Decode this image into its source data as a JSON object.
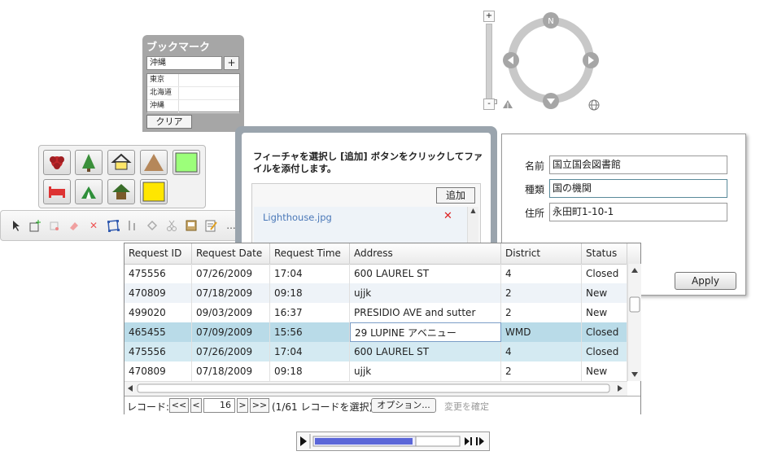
{
  "bookmark": {
    "title": "ブックマーク",
    "input_value": "沖縄",
    "add_label": "+",
    "items": [
      "東京",
      "北海道",
      "沖縄"
    ],
    "clear_label": "クリア"
  },
  "navigation": {
    "zoom_in": "+",
    "zoom_out": "-",
    "north_label": "N"
  },
  "edit_toolbar": {
    "more_label": "..."
  },
  "attachment": {
    "instruction": "フィーチャを選択し [追加] ボタンをクリックしてファイルを添付します。",
    "add_label": "追加",
    "file_name": "Lighthouse.jpg"
  },
  "attribute_form": {
    "fields": [
      {
        "label": "名前",
        "value": "国立国会図書館"
      },
      {
        "label": "種類",
        "value": "国の機関"
      },
      {
        "label": "住所",
        "value": "永田町1-10-1"
      }
    ],
    "apply_label": "Apply"
  },
  "grid": {
    "columns": [
      "Request ID",
      "Request Date",
      "Request Time",
      "Address",
      "District",
      "Status"
    ],
    "rows": [
      [
        "475556",
        "07/26/2009",
        "17:04",
        "600 LAUREL ST",
        "4",
        "Closed"
      ],
      [
        "470809",
        "07/18/2009",
        "09:18",
        "ujjk",
        "2",
        "New"
      ],
      [
        "499020",
        "09/03/2009",
        "16:37",
        "PRESIDIO AVE and sutter",
        "2",
        "New"
      ],
      [
        "465455",
        "07/09/2009",
        "15:56",
        "29 LUPINE アベニュー",
        "WMD",
        "Closed"
      ],
      [
        "475556",
        "07/26/2009",
        "17:04",
        "600 LAUREL ST",
        "4",
        "Closed"
      ],
      [
        "470809",
        "07/18/2009",
        "09:18",
        "ujjk",
        "2",
        "New"
      ]
    ],
    "pager": {
      "label": "レコード:",
      "first": "<<",
      "prev": "<",
      "page": "16",
      "next": ">",
      "last": ">>",
      "status": "(1/61 レコードを選択)",
      "options_label": "オプション...",
      "commit_label": "変更を確定"
    }
  },
  "colors": {
    "selected_row": "#b9dbe8",
    "symbol_green": "#9cff7a",
    "symbol_yellow": "#ffe600"
  }
}
